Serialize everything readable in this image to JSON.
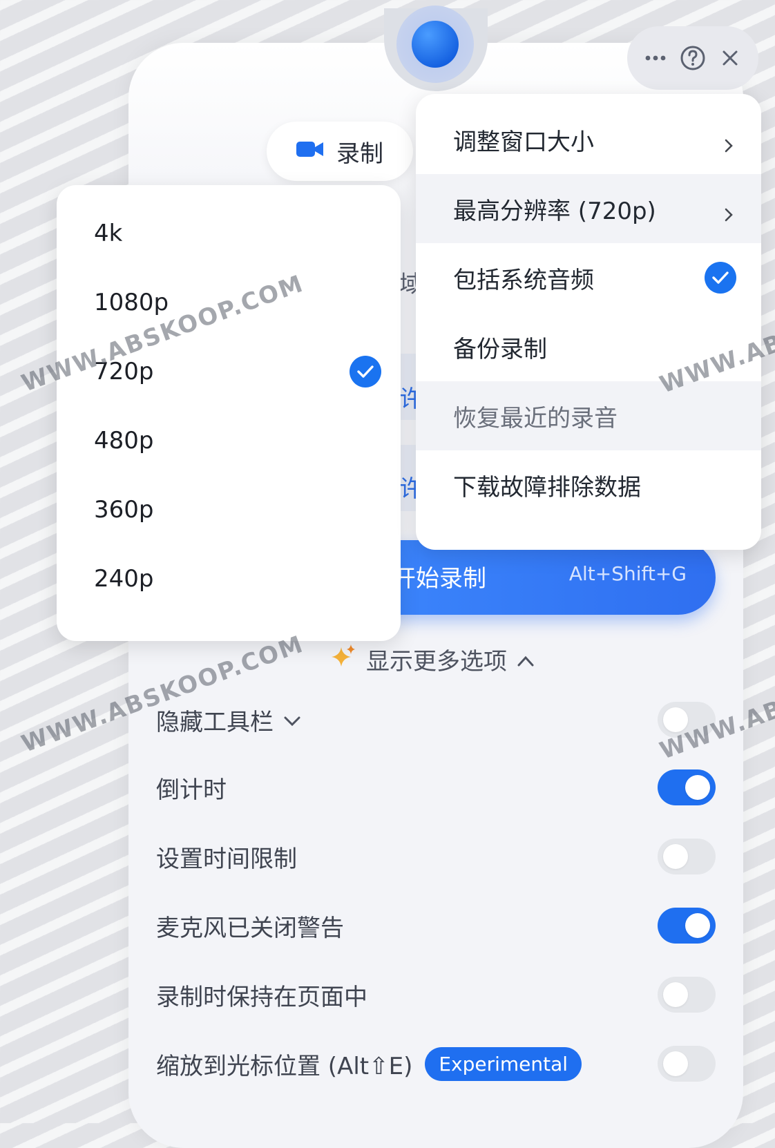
{
  "header": {
    "record_tab_label": "录制",
    "icons": [
      "more-icon",
      "help-icon",
      "close-icon"
    ]
  },
  "settings_menu": {
    "items": [
      {
        "label": "调整窗口大小",
        "has_submenu": true
      },
      {
        "label": "最高分辨率 (720p)",
        "has_submenu": true
      },
      {
        "label": "包括系统音频",
        "checked": true
      },
      {
        "label": "备份录制"
      },
      {
        "label": "恢复最近的录音"
      },
      {
        "label": "下载故障排除数据"
      }
    ]
  },
  "resolution_menu": {
    "options": [
      "4k",
      "1080p",
      "720p",
      "480p",
      "360p",
      "240p"
    ],
    "selected": "720p"
  },
  "background_peeks": {
    "peek1": "域",
    "peek2": "许",
    "peek3": "许"
  },
  "start_button": {
    "label": "开始录制",
    "hotkey": "Alt+Shift+G"
  },
  "more_options": {
    "label": "显示更多选项"
  },
  "options": [
    {
      "label": "隐藏工具栏",
      "on": false
    },
    {
      "label": "倒计时",
      "on": true
    },
    {
      "label": "设置时间限制",
      "on": false
    },
    {
      "label": "麦克风已关闭警告",
      "on": true
    },
    {
      "label": "录制时保持在页面中",
      "on": false
    },
    {
      "label": "缩放到光标位置 (Alt⇧E)",
      "on": false,
      "badge": "Experimental"
    }
  ],
  "watermark": "WWW.ABSKOOP.COM",
  "colors": {
    "accent": "#1f6ff0",
    "panel_bg": "#f3f4f8"
  }
}
